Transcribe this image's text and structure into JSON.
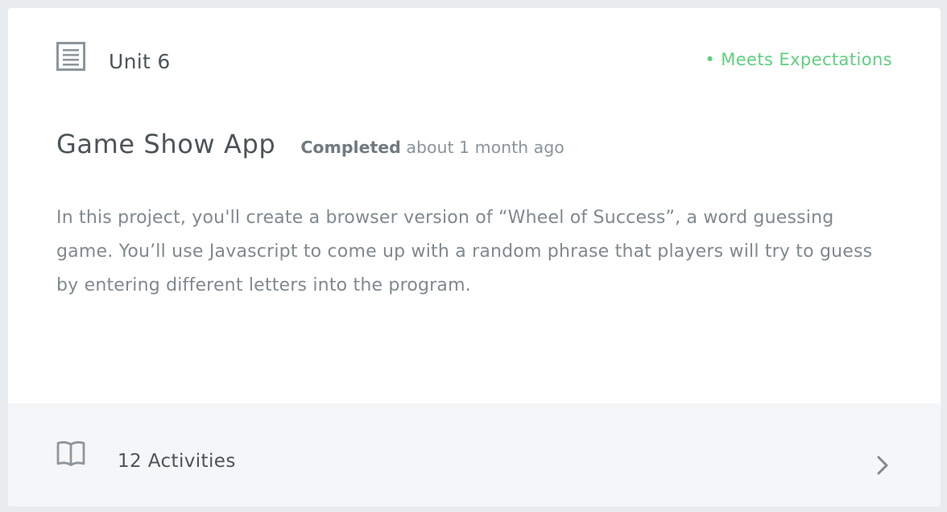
{
  "unit": {
    "label": "Unit 6",
    "icon": "document-list-icon"
  },
  "status": {
    "text": "• Meets Expectations",
    "color": "#5fcf80"
  },
  "project": {
    "title": "Game Show App",
    "completed_label": "Completed",
    "completed_time": "about 1 month ago",
    "description": "In this project, you'll create a browser version of “Wheel of Success”, a word guessing game. You’ll use Javascript to come up with a random phrase that players will try to guess by entering different letters into the program."
  },
  "footer": {
    "icon": "book-icon",
    "activities_label": "12 Activities",
    "chevron": "chevron-right-icon"
  }
}
